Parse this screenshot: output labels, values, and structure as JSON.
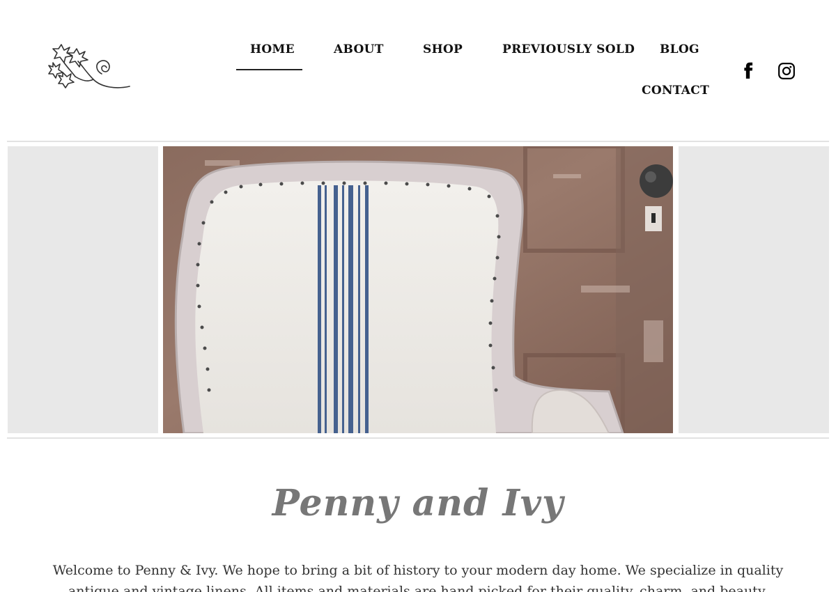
{
  "nav": {
    "items": [
      {
        "label": "HOME",
        "active": true
      },
      {
        "label": "ABOUT"
      },
      {
        "label": "SHOP"
      },
      {
        "label": "PREVIOUSLY SOLD"
      },
      {
        "label": "BLOG"
      },
      {
        "label": "CONTACT"
      }
    ]
  },
  "social": {
    "facebook_icon": "facebook-icon",
    "instagram_icon": "instagram-icon"
  },
  "logo": {
    "icon": "ivy-vine-logo"
  },
  "hero": {
    "icon": "upholstered-chair-photo"
  },
  "intro": {
    "title": "Penny and Ivy",
    "paragraph": "Welcome to Penny & Ivy. We hope to bring a bit of history to your modern day home. We specialize in quality antique and vintage linens. All items and materials are hand picked for their quality, charm, and beauty."
  },
  "colors": {
    "panel": "#e8e8e8",
    "divider": "#e2e2e2",
    "script": "#777777"
  }
}
